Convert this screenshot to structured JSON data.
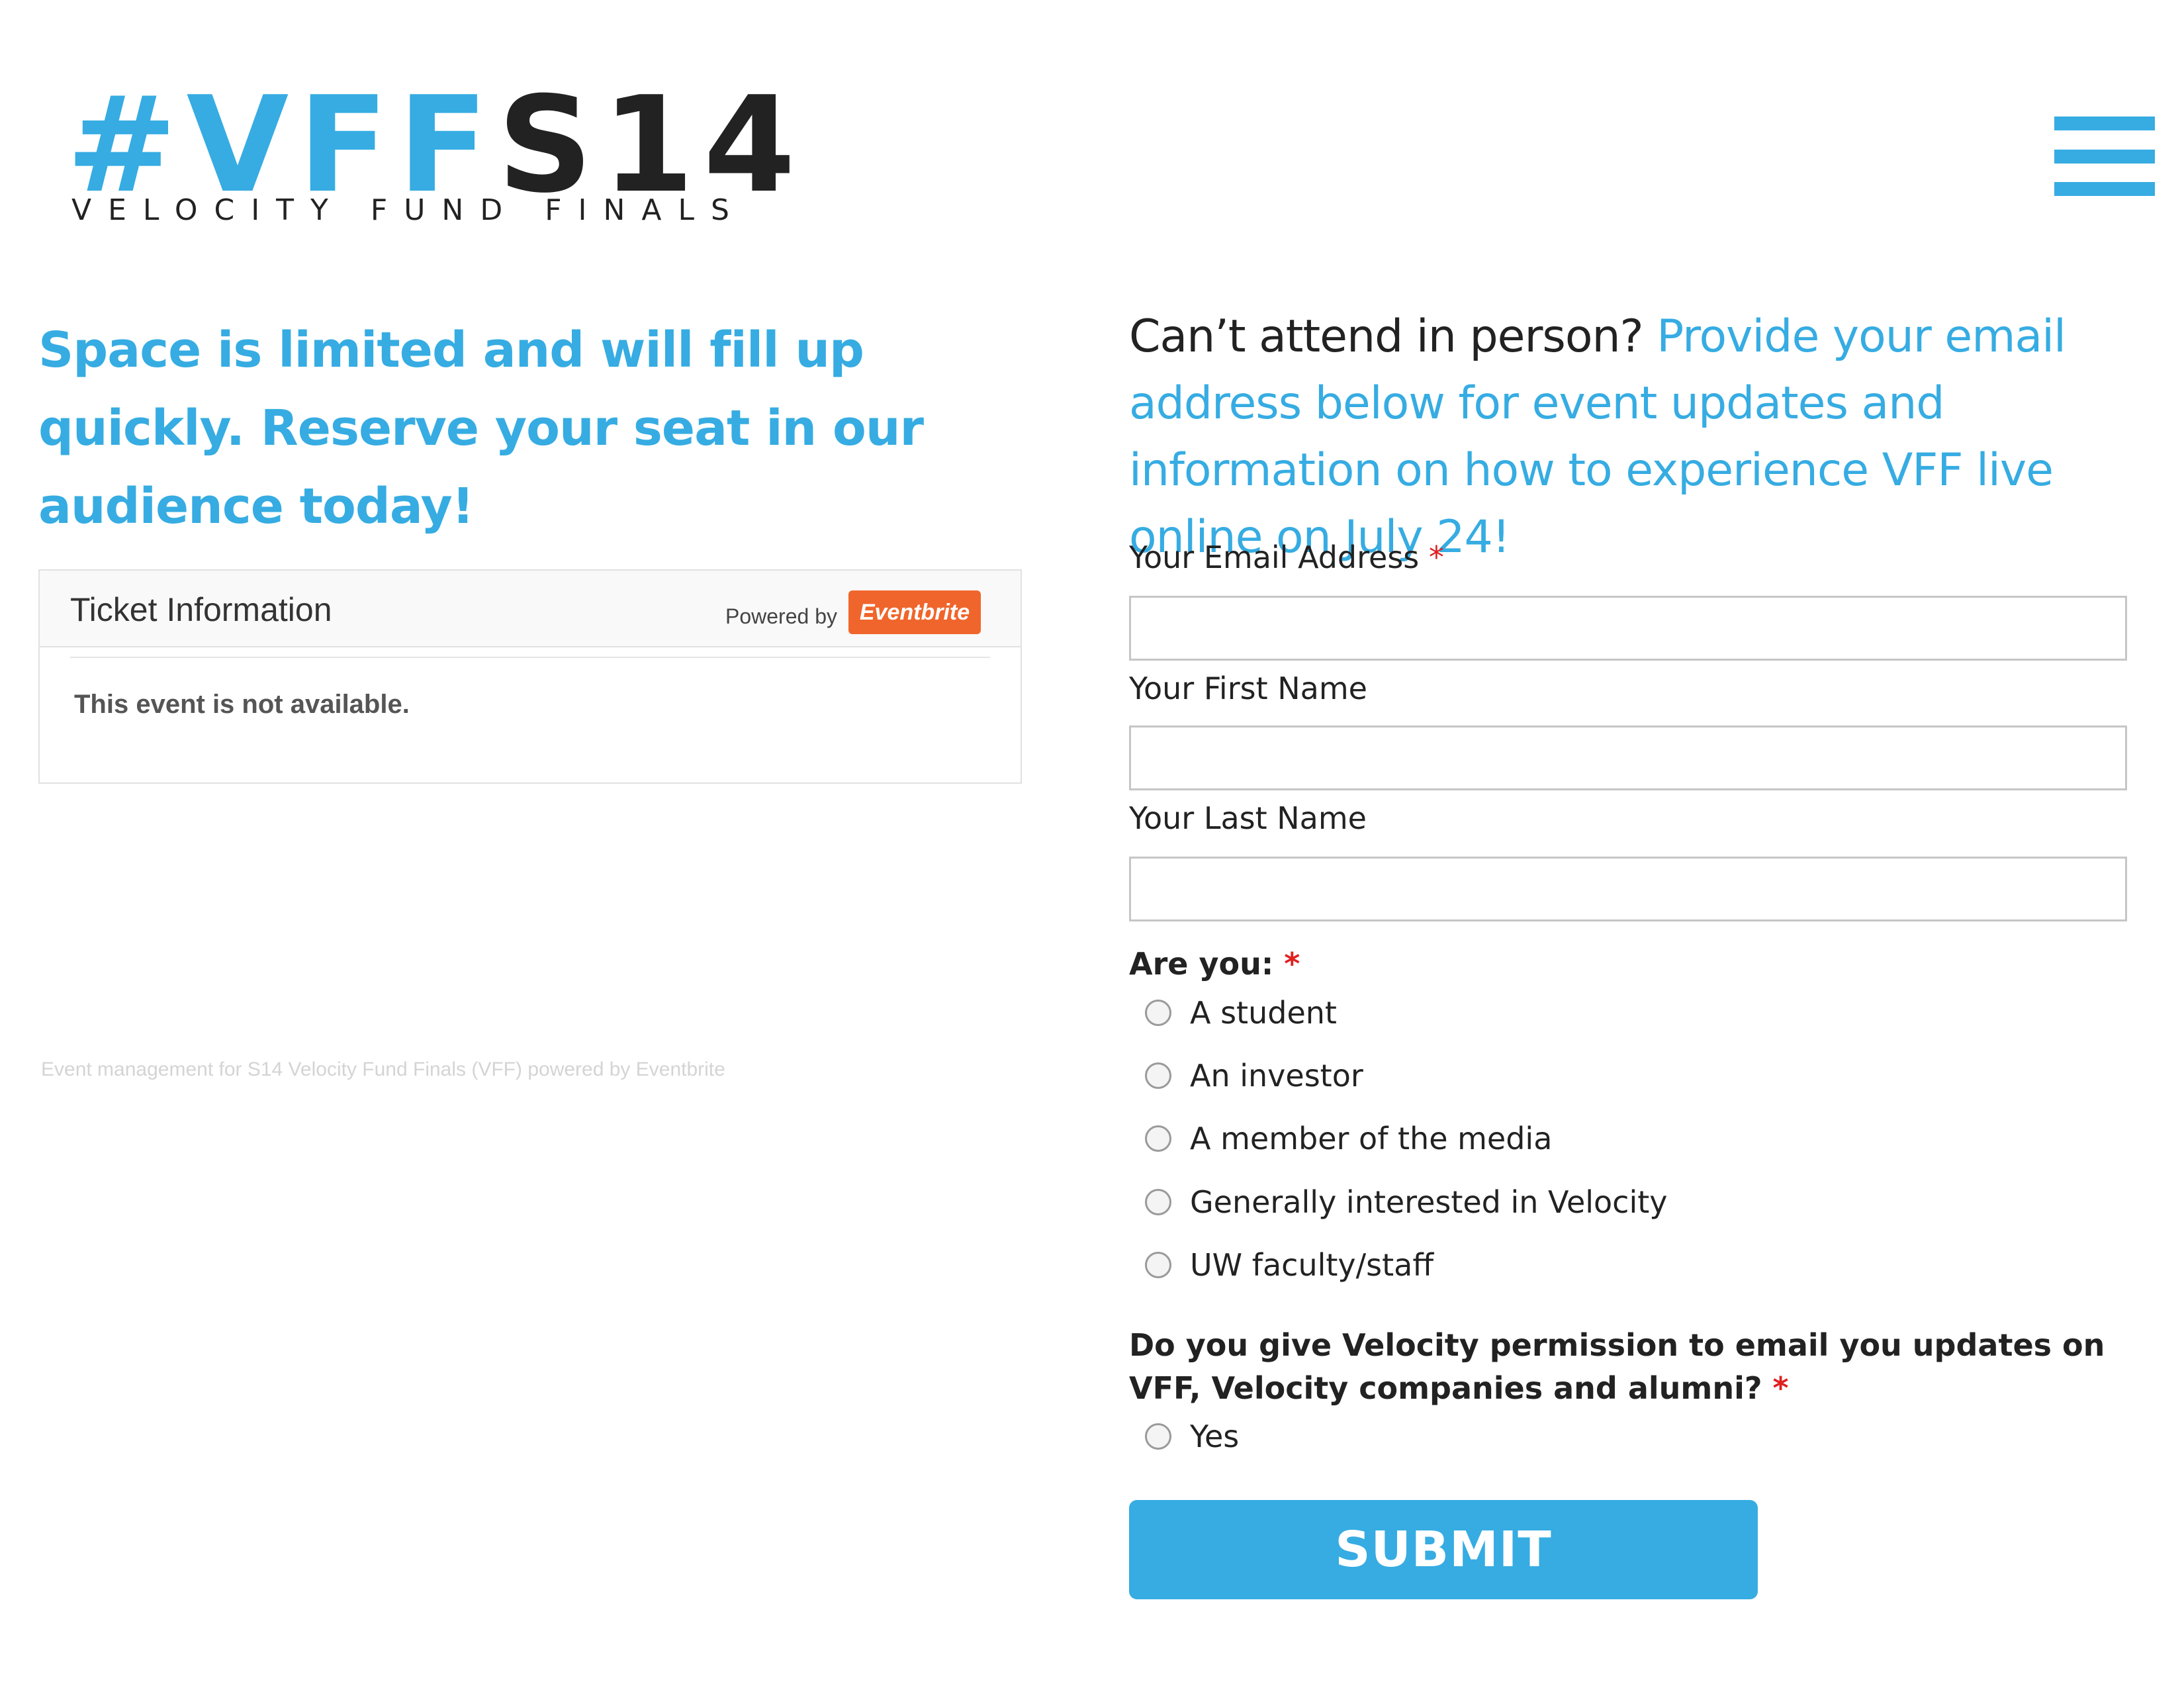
{
  "brand": {
    "hash": "#VFF",
    "code": "S14",
    "subtitle": "VELOCITY FUND FINALS"
  },
  "menu": {
    "icon": "hamburger-menu-icon"
  },
  "left": {
    "headline": "Space is limited and will fill up quickly. Reserve your seat in our audience today!",
    "ticket": {
      "title": "Ticket Information",
      "powered_by": "Powered by",
      "provider": "Eventbrite",
      "message": "This event is not available."
    },
    "footer_note": "Event management for S14 Velocity Fund Finals (VFF) powered by Eventbrite"
  },
  "right": {
    "intro_lead": "Can’t attend in person?",
    "intro_rest": "Provide your email address below for event updates and information on how to experience VFF live online on July 24!",
    "required_marker": "*",
    "fields": {
      "email": {
        "label": "Your Email Address",
        "value": ""
      },
      "first_name": {
        "label": "Your First Name",
        "value": ""
      },
      "last_name": {
        "label": "Your Last Name",
        "value": ""
      }
    },
    "role_question": "Are you:",
    "role_options": [
      "A student",
      "An investor",
      "A member of the media",
      "Generally interested in Velocity",
      "UW faculty/staff"
    ],
    "permission_question": "Do you give Velocity permission to email you updates on VFF, Velocity companies and alumni?",
    "permission_options": [
      "Yes"
    ],
    "submit_label": "SUBMIT"
  },
  "colors": {
    "accent": "#36ace2",
    "required": "#e02020",
    "eventbrite": "#f0652b"
  }
}
